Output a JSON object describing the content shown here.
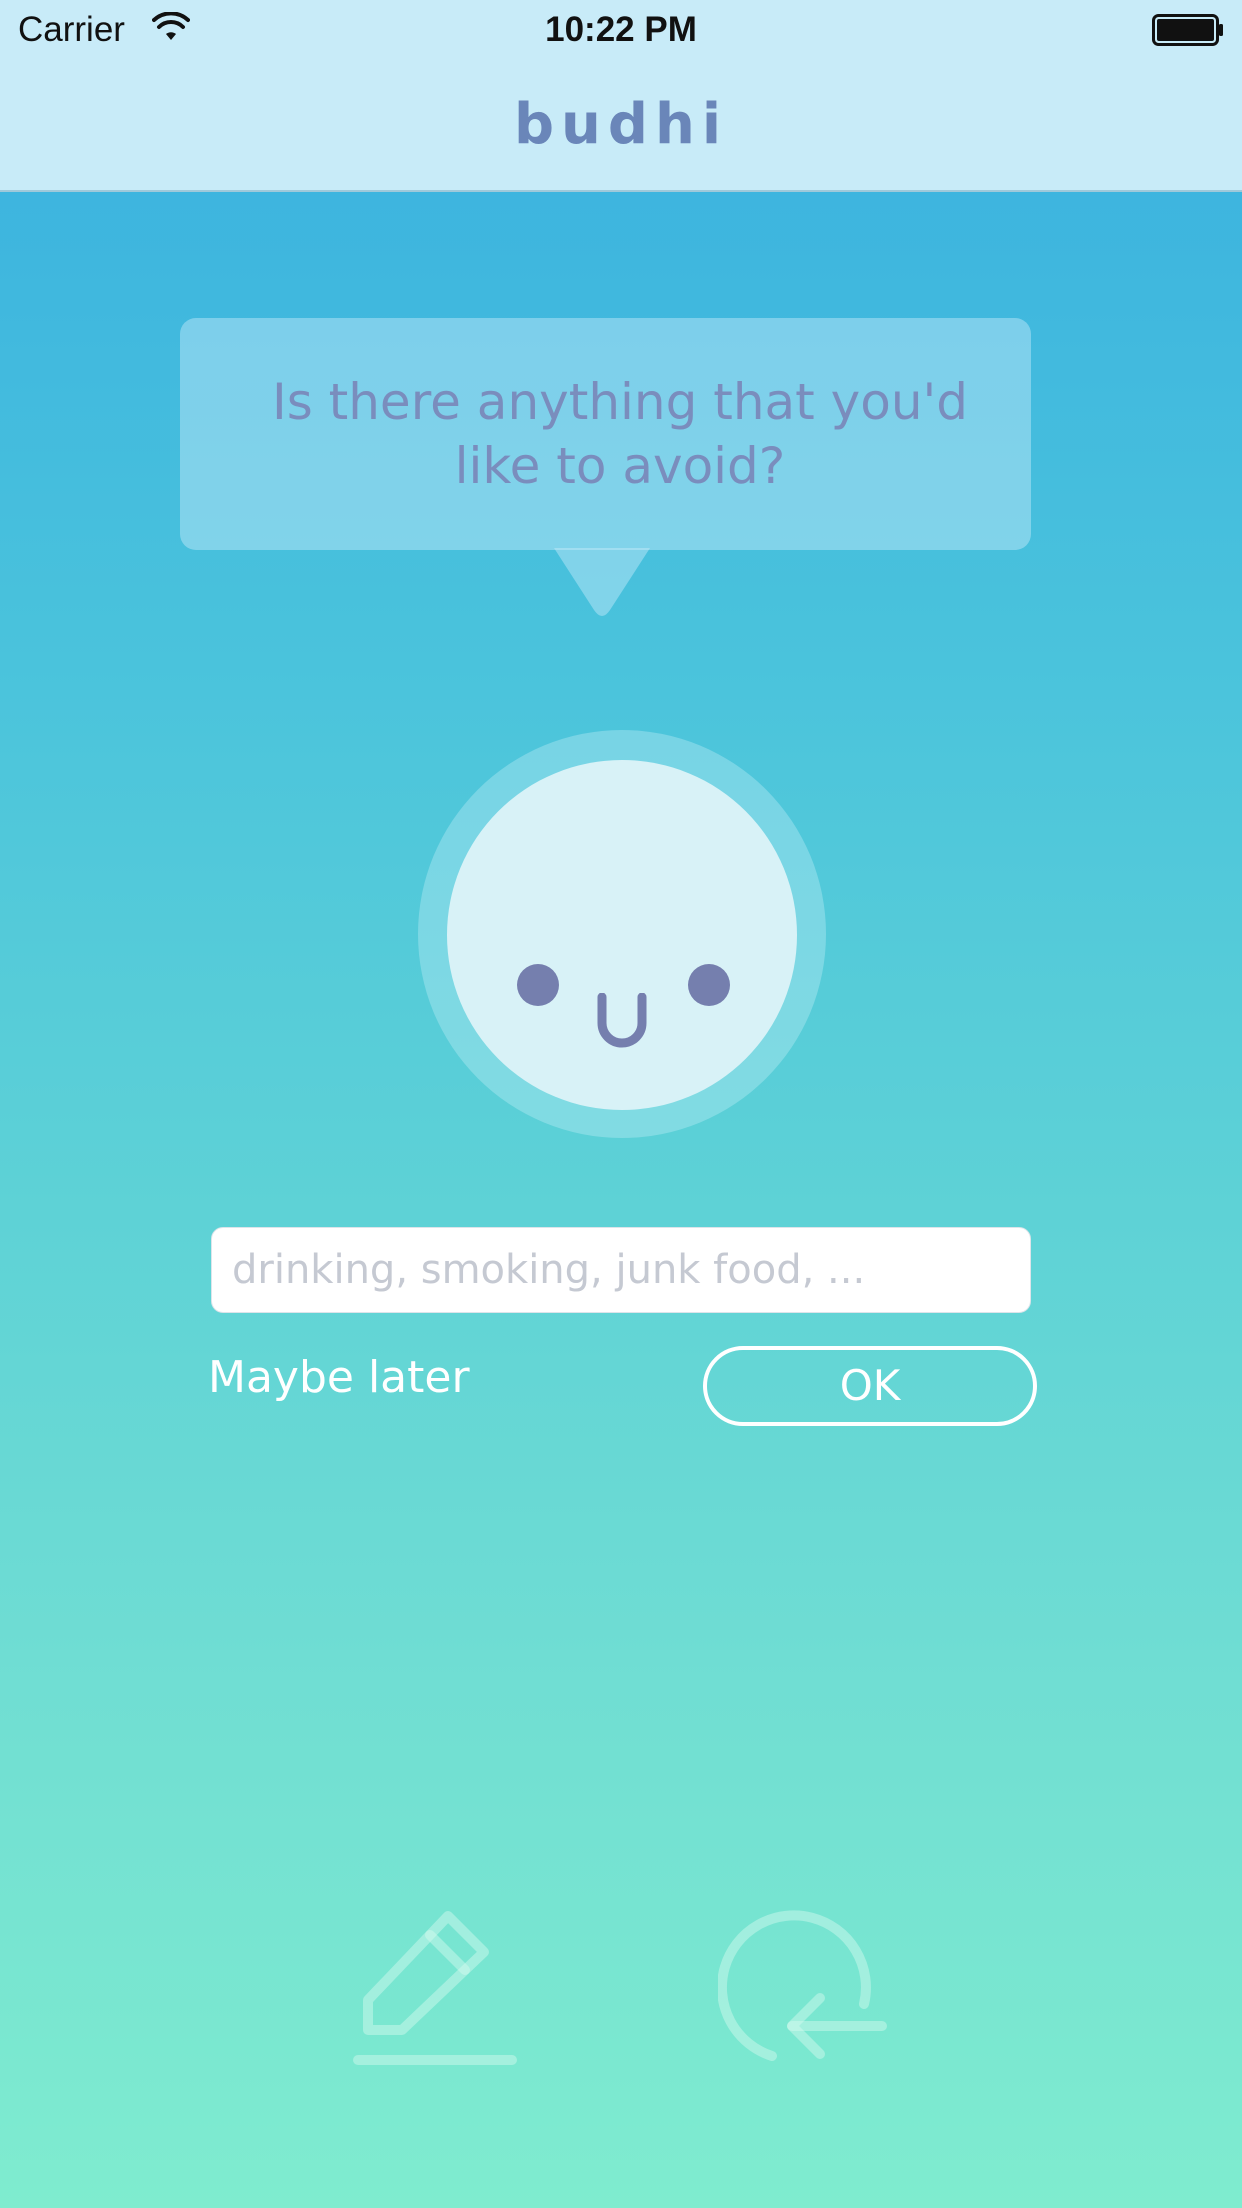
{
  "status_bar": {
    "carrier": "Carrier",
    "time": "10:22 PM",
    "icons": [
      "wifi-icon",
      "battery-icon"
    ]
  },
  "nav": {
    "title": "budhi"
  },
  "prompt": {
    "question": "Is there anything that you'd like to avoid?"
  },
  "avatar": {
    "expression": "smiling-face"
  },
  "input": {
    "value": "",
    "placeholder": "drinking, smoking, junk food, ..."
  },
  "actions": {
    "skip_label": "Maybe later",
    "ok_label": "OK"
  },
  "toolbar": {
    "icons": [
      "edit-icon",
      "return-icon"
    ]
  },
  "colors": {
    "gradient_top": "#38afe0",
    "gradient_bottom": "#7feccf",
    "navbar_bg": "#c8ebf8",
    "accent_text": "#6a86b9",
    "face_features": "#757fae"
  }
}
